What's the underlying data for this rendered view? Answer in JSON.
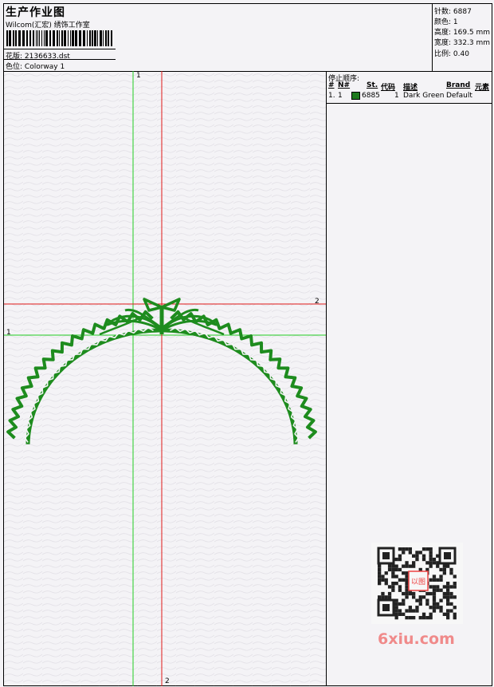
{
  "header": {
    "title": "生产作业图",
    "subtitle": "Wilcom(汇宏) 绣饰工作室",
    "design_label": "花版:",
    "design_value": "2136633.dst",
    "colorway_label": "色位:",
    "colorway_value": "Colorway 1"
  },
  "stats": {
    "stitches": "针数: 6887",
    "colors": "颜色: 1",
    "height": "高度: 169.5 mm",
    "width": "宽度: 332.3 mm",
    "scale": "比例: 0.40"
  },
  "stop_sequence": {
    "title": "停止顺序:",
    "columns": [
      "#",
      "N#",
      "St.",
      "代码",
      "描述",
      "Brand",
      "元素"
    ],
    "rows": [
      {
        "index": "1.",
        "needle": "1",
        "stitches": "6885",
        "code": "1",
        "description": "Dark Green",
        "brand": "Default",
        "color": "#1e7a1e"
      }
    ]
  },
  "axes": {
    "green_vertical": "1",
    "green_horizontal": "1",
    "red_vertical": "2",
    "red_horizontal": "2"
  },
  "colors": {
    "thread": "#1e8c1e",
    "green_axis": "#22cc22",
    "red_axis": "#e01818"
  },
  "watermark": {
    "text": "6xiu.com",
    "stamp": "以图"
  }
}
